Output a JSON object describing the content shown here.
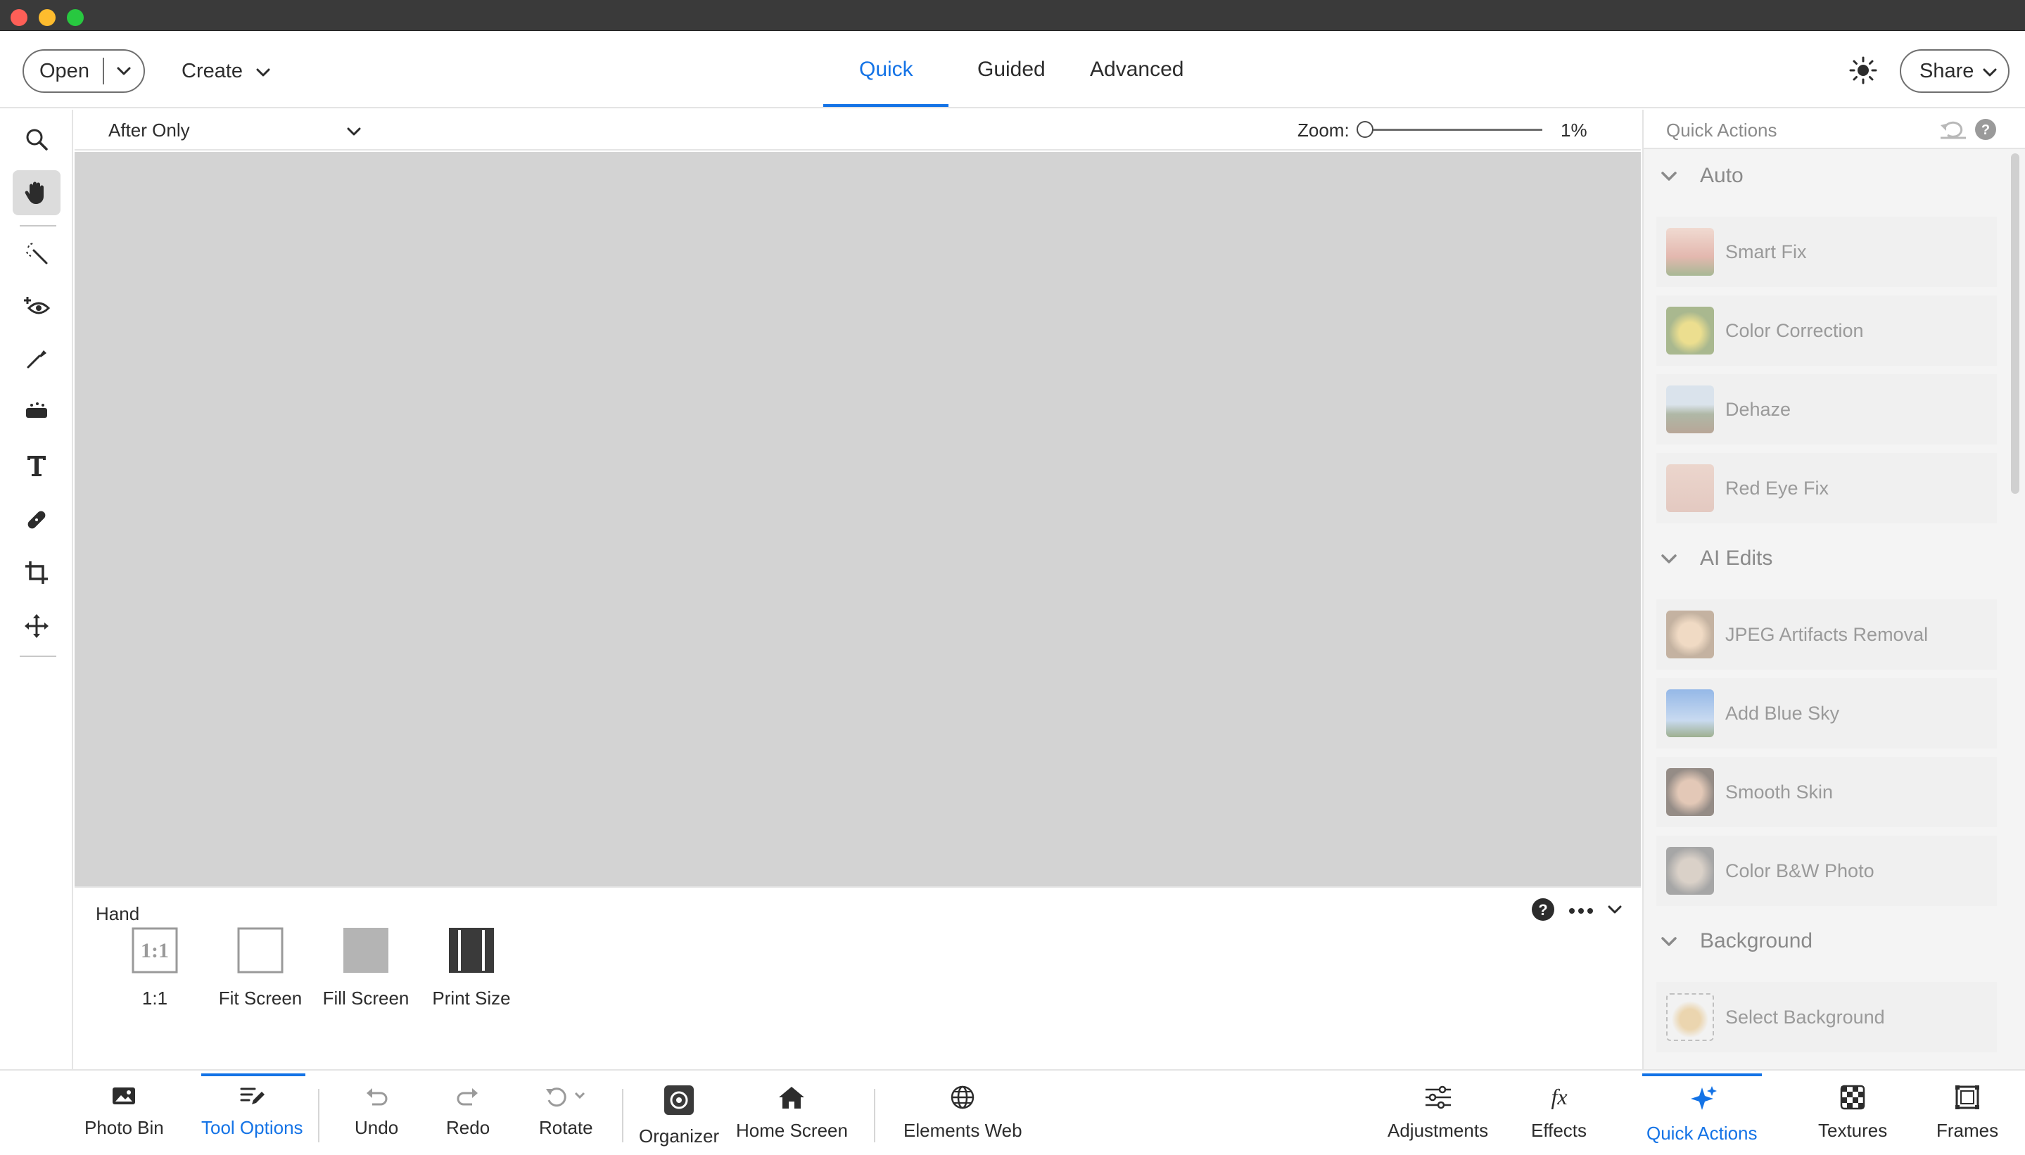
{
  "header": {
    "open_label": "Open",
    "create_label": "Create",
    "modes": [
      "Quick",
      "Guided",
      "Advanced"
    ],
    "active_mode": "Quick",
    "share_label": "Share"
  },
  "view": {
    "selected": "After Only",
    "zoom_label": "Zoom:",
    "zoom_value": "1%",
    "zoom_level": 0.01
  },
  "tools": [
    {
      "icon": "zoom-icon"
    },
    {
      "icon": "hand-icon",
      "active": true
    },
    {
      "icon": "quick-selection-icon"
    },
    {
      "icon": "red-eye-icon"
    },
    {
      "icon": "whiten-teeth-icon"
    },
    {
      "icon": "sponge-icon"
    },
    {
      "icon": "type-icon"
    },
    {
      "icon": "spot-healing-icon"
    },
    {
      "icon": "crop-icon"
    },
    {
      "icon": "move-icon"
    }
  ],
  "tool_options": {
    "title": "Hand",
    "items": [
      {
        "label": "1:1",
        "icon_text": "1:1"
      },
      {
        "label": "Fit Screen"
      },
      {
        "label": "Fill Screen"
      },
      {
        "label": "Print Size"
      }
    ]
  },
  "quick_actions": {
    "title": "Quick Actions",
    "sections": {
      "auto": "Auto",
      "ai_edits": "AI Edits",
      "background": "Background"
    },
    "items": [
      {
        "label": "Smart Fix",
        "color": "#d98a7a"
      },
      {
        "label": "Color Correction",
        "color": "#c9b23a"
      },
      {
        "label": "Dehaze",
        "color": "#8aa0b0"
      },
      {
        "label": "Red Eye Fix",
        "color": "#d9a99a"
      },
      {
        "label": "JPEG Artifacts Removal",
        "color": "#c9a07a"
      },
      {
        "label": "Add Blue Sky",
        "color": "#6f9fd6"
      },
      {
        "label": "Smooth Skin",
        "color": "#a07a60"
      },
      {
        "label": "Color B&W Photo",
        "color": "#a0a0a0"
      },
      {
        "label": "Select Background",
        "color": "#e8c07a"
      }
    ]
  },
  "bottom_bar": {
    "photo_bin": "Photo Bin",
    "tool_options": "Tool Options",
    "undo": "Undo",
    "redo": "Redo",
    "rotate": "Rotate",
    "organizer": "Organizer",
    "home_screen": "Home Screen",
    "elements_web": "Elements Web",
    "adjustments": "Adjustments",
    "effects": "Effects",
    "quick_actions": "Quick Actions",
    "textures": "Textures",
    "frames": "Frames"
  },
  "colors": {
    "accent": "#1473e6",
    "canvas": "#d3d3d3"
  }
}
